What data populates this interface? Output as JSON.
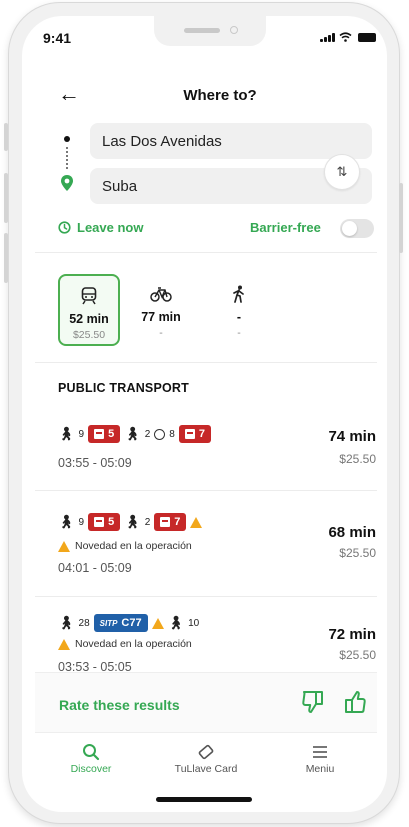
{
  "status_bar": {
    "time": "9:41"
  },
  "header": {
    "title": "Where to?"
  },
  "route": {
    "from": "Las Dos Avenidas",
    "to": "Suba"
  },
  "options": {
    "leave_now": "Leave now",
    "barrier_free": "Barrier-free",
    "barrier_free_on": false
  },
  "modes": [
    {
      "icon": "tram-icon",
      "time": "52 min",
      "price": "$25.50",
      "selected": true
    },
    {
      "icon": "bike-icon",
      "time": "77 min",
      "price": "-",
      "selected": false
    },
    {
      "icon": "walk-icon",
      "time": "-",
      "price": "-",
      "selected": false
    }
  ],
  "section_title": "PUBLIC TRANSPORT",
  "results": [
    {
      "walk1": "9",
      "route1": "5",
      "walk2": "2",
      "wait": "8",
      "route2": "7",
      "times": "03:55 - 05:09",
      "duration": "74 min",
      "price": "$25.50"
    },
    {
      "walk1": "9",
      "route1": "5",
      "walk2": "2",
      "route2": "7",
      "notice": "Novedad en la operación",
      "times": "04:01 - 05:09",
      "duration": "68 min",
      "price": "$25.50"
    },
    {
      "walk1": "28",
      "route_label": "SITP",
      "route1": "C77",
      "walk2": "10",
      "notice": "Novedad en la operación",
      "times": "03:53 - 05:05",
      "duration": "72 min",
      "price": "$25.50"
    }
  ],
  "rate": {
    "label": "Rate these results"
  },
  "tabs": [
    {
      "icon": "search-icon",
      "label": "Discover",
      "active": true
    },
    {
      "icon": "card-icon",
      "label": "TuLlave Card",
      "active": false
    },
    {
      "icon": "menu-icon",
      "label": "Meniu",
      "active": false
    }
  ],
  "colors": {
    "accent": "#35a853",
    "transit_red": "#c62828",
    "sitp_blue": "#2060a8",
    "warning": "#f2a71b"
  }
}
